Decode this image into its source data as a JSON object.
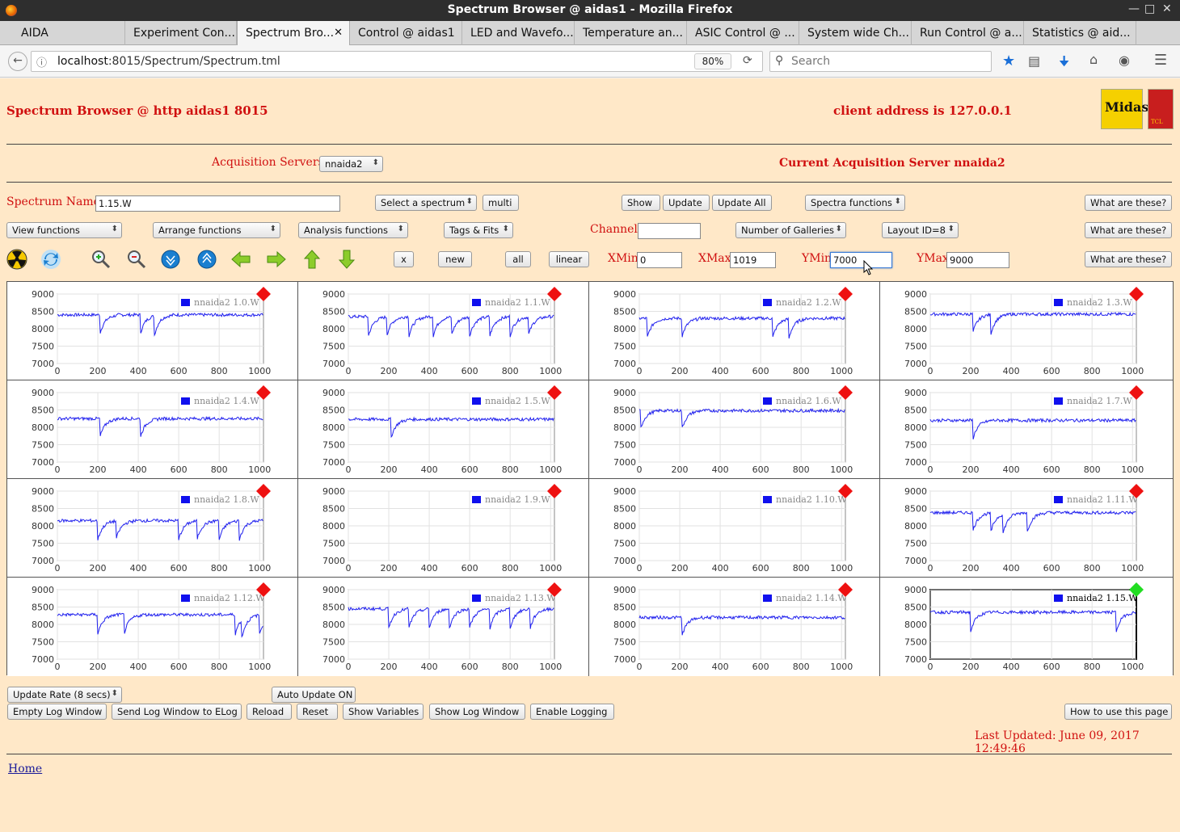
{
  "window": {
    "title": "Spectrum Browser @ aidas1 - Mozilla Firefox"
  },
  "tabs": [
    {
      "label": "AIDA"
    },
    {
      "label": "Experiment Con..."
    },
    {
      "label": "Spectrum Bro..."
    },
    {
      "label": "Control @ aidas1"
    },
    {
      "label": "LED and Wavefo..."
    },
    {
      "label": "Temperature an..."
    },
    {
      "label": "ASIC Control @ ..."
    },
    {
      "label": "System wide Ch..."
    },
    {
      "label": "Run Control @ a..."
    },
    {
      "label": "Statistics @ aid..."
    }
  ],
  "nav": {
    "url_host": "localhost",
    "url_rest": ":8015/Spectrum/Spectrum.tml",
    "zoom": "80%",
    "search_placeholder": "Search"
  },
  "header": {
    "title": "Spectrum Browser @ http aidas1 8015",
    "client": "client address is 127.0.0.1"
  },
  "acq": {
    "label": "Acquisition Servers",
    "value": "nnaida2",
    "current": "Current Acquisition Server nnaida2"
  },
  "row1": {
    "spectrum_label": "Spectrum Name:",
    "spectrum_value": "1.15.W",
    "select": "Select a spectrum",
    "multi": "multi",
    "show": "Show",
    "update": "Update",
    "update_all": "Update All",
    "spectra_functions": "Spectra functions",
    "what": "What are these?"
  },
  "row2": {
    "view": "View functions",
    "arrange": "Arrange functions",
    "analysis": "Analysis functions",
    "tags": "Tags & Fits",
    "channel_label": "Channel:",
    "channel_value": "",
    "galleries": "Number of Galleries",
    "layout": "Layout ID=8",
    "what": "What are these?"
  },
  "row3": {
    "x": "x",
    "new": "new",
    "all": "all",
    "linear": "linear",
    "xmin_label": "XMin",
    "xmin": "0",
    "xmax_label": "XMax",
    "xmax": "1019",
    "ymin_label": "YMin",
    "ymin": "7000",
    "ymax_label": "YMax",
    "ymax": "9000",
    "what": "What are these?"
  },
  "icons": [
    "radiation-icon",
    "refresh-icon",
    "zoom-in-icon",
    "zoom-out-icon",
    "expand-down-icon",
    "expand-up-icon",
    "arrow-left-icon",
    "arrow-right-icon",
    "arrow-up-icon",
    "arrow-down-icon"
  ],
  "chart_data": [
    {
      "type": "line",
      "legend": "nnaida2 1.0.W",
      "status": "red",
      "xlim": [
        0,
        1019
      ],
      "ylim": [
        7000,
        9000
      ],
      "x_ticks": [
        "0",
        "200",
        "400",
        "600",
        "800",
        "1000"
      ],
      "y_ticks": [
        "9000",
        "8500",
        "8000",
        "7500",
        "7000"
      ],
      "baseline": 8400,
      "dips": [
        210,
        410,
        480
      ]
    },
    {
      "type": "line",
      "legend": "nnaida2 1.1.W",
      "status": "red",
      "xlim": [
        0,
        1019
      ],
      "ylim": [
        7000,
        9000
      ],
      "x_ticks": [
        "0",
        "200",
        "400",
        "600",
        "800",
        "1000"
      ],
      "y_ticks": [
        "9000",
        "8500",
        "8000",
        "7500",
        "7000"
      ],
      "baseline": 8350,
      "dips": [
        100,
        190,
        300,
        420,
        510,
        600,
        700,
        800,
        890
      ]
    },
    {
      "type": "line",
      "legend": "nnaida2 1.2.W",
      "status": "red",
      "xlim": [
        0,
        1019
      ],
      "ylim": [
        7000,
        9000
      ],
      "x_ticks": [
        "0",
        "200",
        "400",
        "600",
        "800",
        "1000"
      ],
      "y_ticks": [
        "9000",
        "8500",
        "8000",
        "7500",
        "7000"
      ],
      "baseline": 8300,
      "dips": [
        40,
        210,
        660,
        740
      ]
    },
    {
      "type": "line",
      "legend": "nnaida2 1.3.W",
      "status": "red",
      "xlim": [
        0,
        1019
      ],
      "ylim": [
        7000,
        9000
      ],
      "x_ticks": [
        "0",
        "200",
        "400",
        "600",
        "800",
        "1000"
      ],
      "y_ticks": [
        "9000",
        "8500",
        "8000",
        "7500",
        "7000"
      ],
      "baseline": 8420,
      "dips": [
        210,
        300
      ]
    },
    {
      "type": "line",
      "legend": "nnaida2 1.4.W",
      "status": "red",
      "xlim": [
        0,
        1019
      ],
      "ylim": [
        7000,
        9000
      ],
      "x_ticks": [
        "0",
        "200",
        "400",
        "600",
        "800",
        "1000"
      ],
      "y_ticks": [
        "9000",
        "8500",
        "8000",
        "7500",
        "7000"
      ],
      "baseline": 8250,
      "dips": [
        210,
        410
      ]
    },
    {
      "type": "line",
      "legend": "nnaida2 1.5.W",
      "status": "red",
      "xlim": [
        0,
        1019
      ],
      "ylim": [
        7000,
        9000
      ],
      "x_ticks": [
        "0",
        "200",
        "400",
        "600",
        "800",
        "1000"
      ],
      "y_ticks": [
        "9000",
        "8500",
        "8000",
        "7500",
        "7000"
      ],
      "baseline": 8230,
      "dips": [
        210
      ]
    },
    {
      "type": "line",
      "legend": "nnaida2 1.6.W",
      "status": "red",
      "xlim": [
        0,
        1019
      ],
      "ylim": [
        7000,
        9000
      ],
      "x_ticks": [
        "0",
        "200",
        "400",
        "600",
        "800",
        "1000"
      ],
      "y_ticks": [
        "9000",
        "8500",
        "8000",
        "7500",
        "7000"
      ],
      "baseline": 8480,
      "dips": [
        5,
        210
      ]
    },
    {
      "type": "line",
      "legend": "nnaida2 1.7.W",
      "status": "red",
      "xlim": [
        0,
        1019
      ],
      "ylim": [
        7000,
        9000
      ],
      "x_ticks": [
        "0",
        "200",
        "400",
        "600",
        "800",
        "1000"
      ],
      "y_ticks": [
        "9000",
        "8500",
        "8000",
        "7500",
        "7000"
      ],
      "baseline": 8200,
      "dips": [
        210
      ]
    },
    {
      "type": "line",
      "legend": "nnaida2 1.8.W",
      "status": "red",
      "xlim": [
        0,
        1019
      ],
      "ylim": [
        7000,
        9000
      ],
      "x_ticks": [
        "0",
        "200",
        "400",
        "600",
        "800",
        "1000"
      ],
      "y_ticks": [
        "9000",
        "8500",
        "8000",
        "7500",
        "7000"
      ],
      "baseline": 8150,
      "dips": [
        200,
        290,
        600,
        690,
        800,
        900
      ]
    },
    {
      "type": "line",
      "legend": "nnaida2 1.9.W",
      "status": "red",
      "xlim": [
        0,
        1019
      ],
      "ylim": [
        7000,
        9000
      ],
      "x_ticks": [
        "0",
        "200",
        "400",
        "600",
        "800",
        "1000"
      ],
      "y_ticks": [
        "9000",
        "8500",
        "8000",
        "7500",
        "7000"
      ],
      "baseline": null,
      "dips": []
    },
    {
      "type": "line",
      "legend": "nnaida2 1.10.W",
      "status": "red",
      "xlim": [
        0,
        1019
      ],
      "ylim": [
        7000,
        9000
      ],
      "x_ticks": [
        "0",
        "200",
        "400",
        "600",
        "800",
        "1000"
      ],
      "y_ticks": [
        "9000",
        "8500",
        "8000",
        "7500",
        "7000"
      ],
      "baseline": null,
      "dips": []
    },
    {
      "type": "line",
      "legend": "nnaida2 1.11.W",
      "status": "red",
      "xlim": [
        0,
        1019
      ],
      "ylim": [
        7000,
        9000
      ],
      "x_ticks": [
        "0",
        "200",
        "400",
        "600",
        "800",
        "1000"
      ],
      "y_ticks": [
        "9000",
        "8500",
        "8000",
        "7500",
        "7000"
      ],
      "baseline": 8380,
      "dips": [
        210,
        300,
        360,
        480
      ]
    },
    {
      "type": "line",
      "legend": "nnaida2 1.12.W",
      "status": "red",
      "xlim": [
        0,
        1019
      ],
      "ylim": [
        7000,
        9000
      ],
      "x_ticks": [
        "0",
        "200",
        "400",
        "600",
        "800",
        "1000"
      ],
      "y_ticks": [
        "9000",
        "8500",
        "8000",
        "7500",
        "7000"
      ],
      "baseline": 8280,
      "dips": [
        200,
        330,
        880,
        910,
        1000
      ]
    },
    {
      "type": "line",
      "legend": "nnaida2 1.13.W",
      "status": "red",
      "xlim": [
        0,
        1019
      ],
      "ylim": [
        7000,
        9000
      ],
      "x_ticks": [
        "0",
        "200",
        "400",
        "600",
        "800",
        "1000"
      ],
      "y_ticks": [
        "9000",
        "8500",
        "8000",
        "7500",
        "7000"
      ],
      "baseline": 8450,
      "dips": [
        200,
        300,
        400,
        500,
        600,
        700,
        800,
        900
      ]
    },
    {
      "type": "line",
      "legend": "nnaida2 1.14.W",
      "status": "red",
      "xlim": [
        0,
        1019
      ],
      "ylim": [
        7000,
        9000
      ],
      "x_ticks": [
        "0",
        "200",
        "400",
        "600",
        "800",
        "1000"
      ],
      "y_ticks": [
        "9000",
        "8500",
        "8000",
        "7500",
        "7000"
      ],
      "baseline": 8200,
      "dips": [
        210
      ]
    },
    {
      "type": "line",
      "legend": "nnaida2 1.15.W",
      "status": "green",
      "xlim": [
        0,
        1019
      ],
      "ylim": [
        7000,
        9000
      ],
      "x_ticks": [
        "0",
        "200",
        "400",
        "600",
        "800",
        "1000"
      ],
      "y_ticks": [
        "9000",
        "8500",
        "8000",
        "7500",
        "7000"
      ],
      "baseline": 8350,
      "dips": [
        200,
        920
      ]
    }
  ],
  "footer": {
    "update_rate": "Update Rate (8 secs)",
    "auto_update": "Auto Update ON",
    "empty_log": "Empty Log Window",
    "send_log": "Send Log Window to ELog",
    "reload": "Reload",
    "reset": "Reset",
    "show_vars": "Show Variables",
    "show_log": "Show Log Window",
    "enable_logging": "Enable Logging",
    "howto": "How to use this page",
    "last_updated": "Last Updated: June 09, 2017 12:49:46",
    "home": "Home"
  },
  "colors": {
    "page_bg": "#ffe8c8",
    "accent_red": "#d01010",
    "trace_blue": "#2020ee",
    "status_red": "#ee1111",
    "status_green": "#22dd22"
  }
}
